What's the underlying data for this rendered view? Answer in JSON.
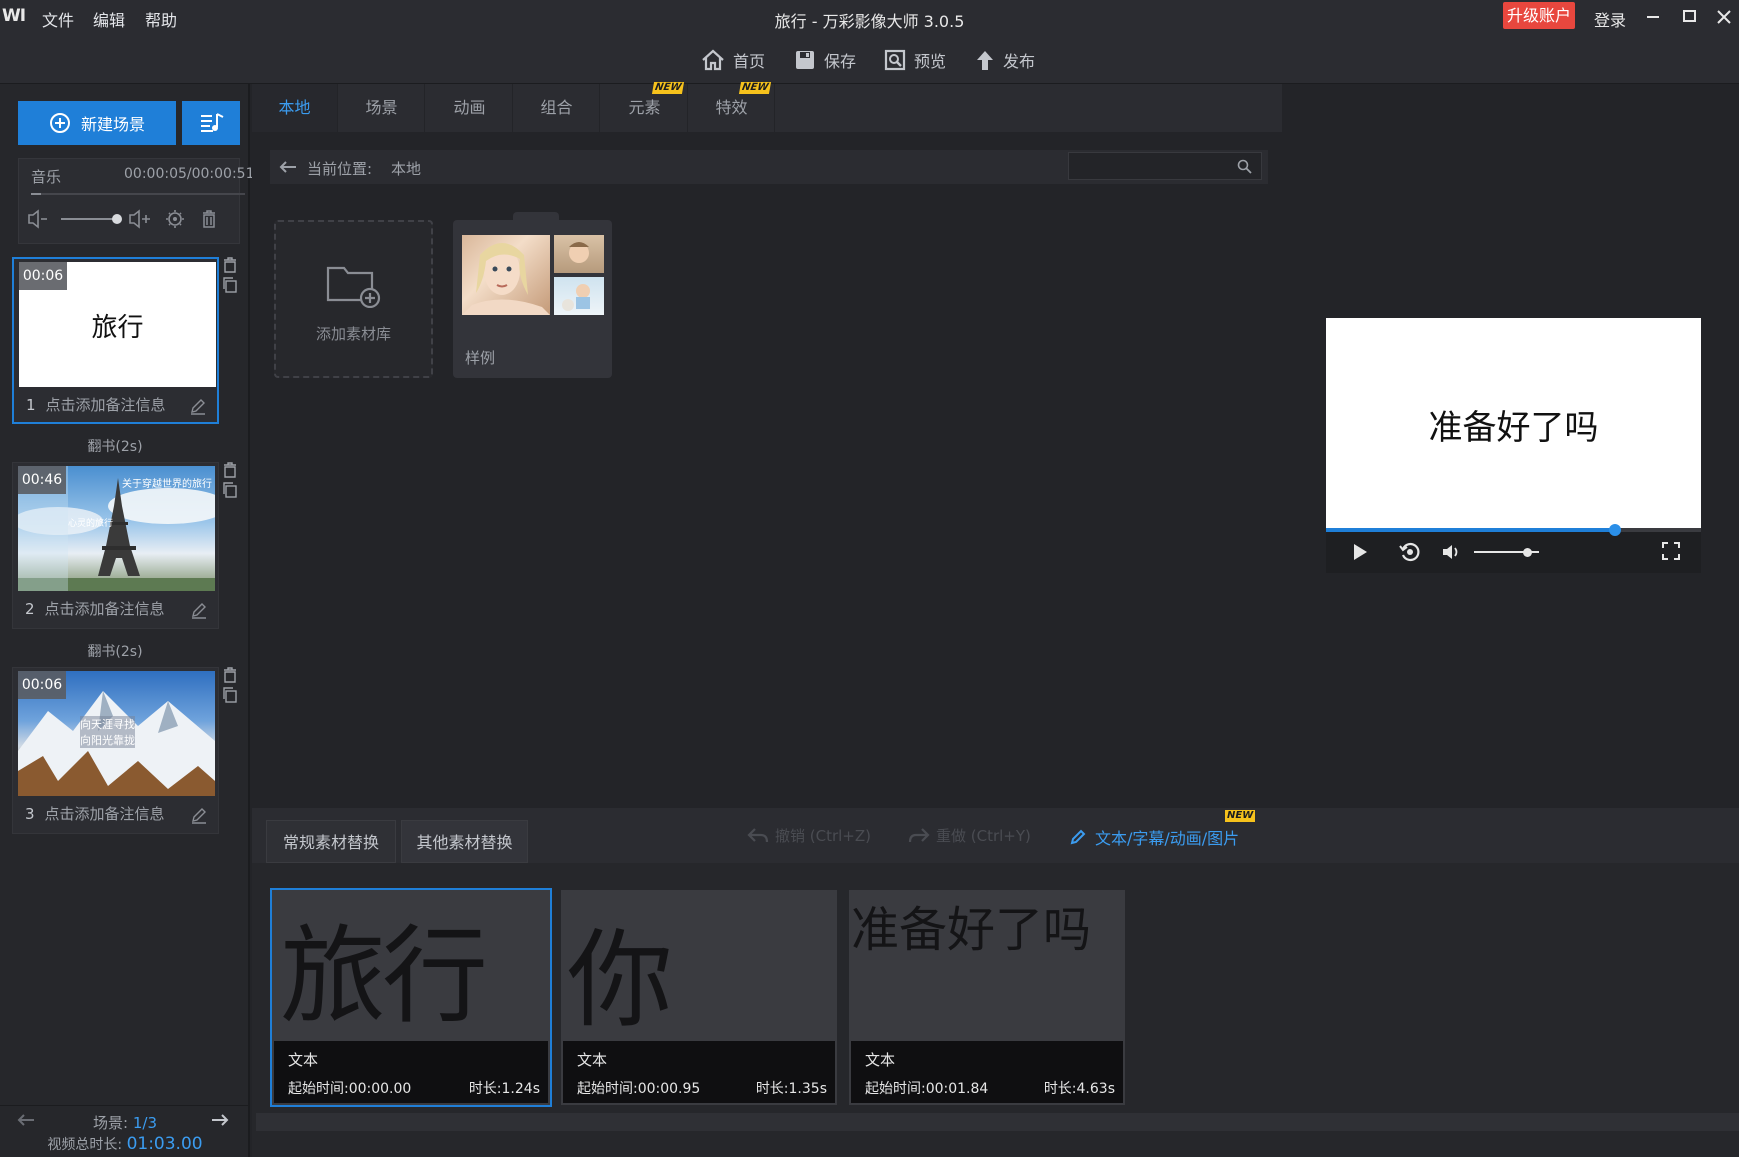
{
  "titlebar": {
    "logo": "WI",
    "menu": [
      "文件",
      "编辑",
      "帮助"
    ],
    "title": "旅行 - 万彩影像大师 3.0.5",
    "upgrade": "升级账户",
    "login": "登录"
  },
  "toolbar": {
    "home": "首页",
    "save": "保存",
    "preview": "预览",
    "publish": "发布"
  },
  "left": {
    "new_scene": "新建场景",
    "music_label": "音乐",
    "music_time": "00:00:05/00:00:51",
    "scenes": [
      {
        "index": "1",
        "badge": "00:06",
        "title": "旅行",
        "note": "点击添加备注信息"
      },
      {
        "index": "2",
        "badge": "00:46",
        "overlay": "关于穿越世界的旅行",
        "overlay2": "心灵的旅行",
        "note": "点击添加备注信息"
      },
      {
        "index": "3",
        "badge": "00:06",
        "overlay": "向天涯寻找",
        "overlay2": "向阳光靠拢",
        "note": "点击添加备注信息"
      }
    ],
    "transitions": [
      "翻书(2s)",
      "翻书(2s)"
    ],
    "footer": {
      "scene_label": "场景: ",
      "scene_value": "1/3",
      "total_label": "视频总时长: ",
      "total_value": "01:03.00"
    }
  },
  "library": {
    "tabs": [
      "本地",
      "场景",
      "动画",
      "组合",
      "元素",
      "特效"
    ],
    "new_badge": "NEW",
    "path_label": "当前位置:",
    "path_value": "本地",
    "add_library": "添加素材库",
    "sample": "样例"
  },
  "preview": {
    "text": "准备好了吗",
    "progress": 0.77,
    "volume": 0.82
  },
  "bottom": {
    "tabs": [
      "常规素材替换",
      "其他素材替换"
    ],
    "undo": "撤销 (Ctrl+Z)",
    "redo": "重做 (Ctrl+Y)",
    "edit_link": "文本/字幕/动画/图片",
    "new_badge": "NEW",
    "cards": [
      {
        "big": "旅行",
        "type": "文本",
        "start": "起始时间:00:00.00",
        "duration": "时长:1.24s"
      },
      {
        "big": "你",
        "type": "文本",
        "start": "起始时间:00:00.95",
        "duration": "时长:1.35s"
      },
      {
        "big": "准备好了吗",
        "type": "文本",
        "start": "起始时间:00:01.84",
        "duration": "时长:4.63s"
      }
    ]
  },
  "colors": {
    "accent": "#1f7fd8",
    "upgrade": "#e8473e",
    "new_tag": "#f6c21c"
  }
}
